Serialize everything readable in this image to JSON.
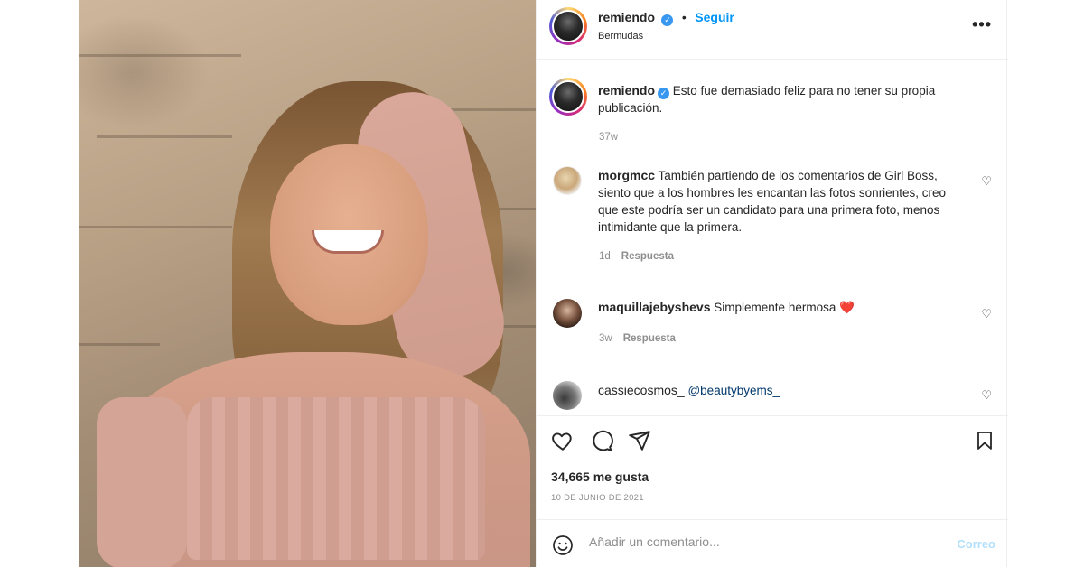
{
  "post": {
    "author": "remiendo",
    "follow_label": "Seguir",
    "location": "Bermudas",
    "more_icon": "more-icon"
  },
  "caption": {
    "username": "remiendo",
    "text": "Esto fue demasiado feliz para no tener su propia publicación.",
    "time": "37w"
  },
  "comments": [
    {
      "username": "morgmcc",
      "text": "También partiendo de los comentarios de Girl Boss, siento que a los hombres les encantan las fotos sonrientes, creo que este podría ser un candidato para una primera foto, menos intimidante que la primera.",
      "time": "1d",
      "reply_label": "Respuesta"
    },
    {
      "username": "maquillajebyshevs",
      "text": "Simplemente hermosa",
      "emoji": "❤️",
      "time": "3w",
      "reply_label": "Respuesta"
    },
    {
      "username": "cassiecosmos_",
      "text": "@beautybyems_"
    }
  ],
  "stats": {
    "likes": "34,665 me gusta",
    "date": "10 DE JUNIO DE 2021"
  },
  "add_comment": {
    "placeholder": "Añadir un comentario...",
    "post_label": "Correo"
  },
  "colors": {
    "accent": "#0095f6",
    "verified": "#3897f0",
    "muted": "#8e8e8e"
  }
}
